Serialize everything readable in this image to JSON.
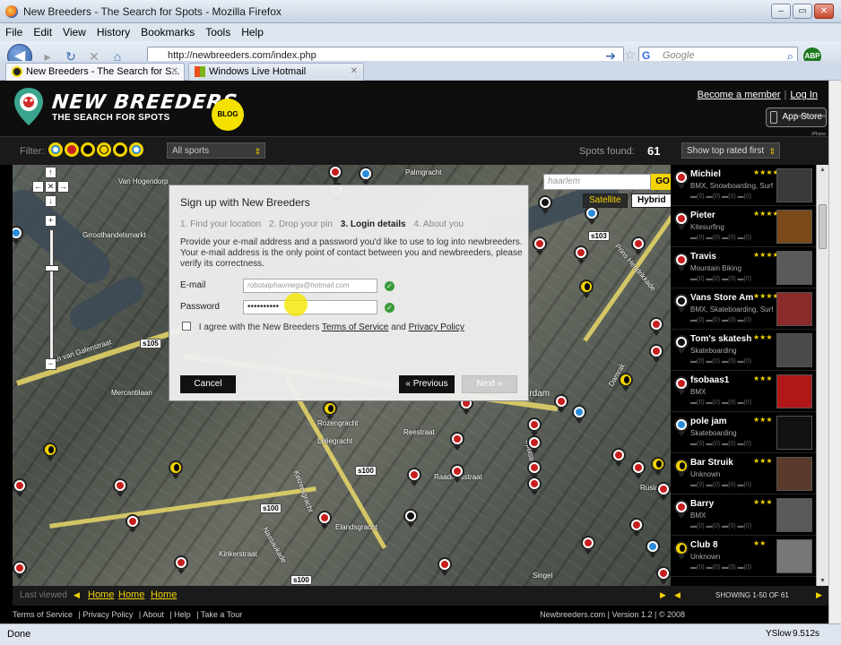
{
  "window": {
    "title": "New Breeders - The Search for Spots - Mozilla Firefox"
  },
  "menu": [
    "File",
    "Edit",
    "View",
    "History",
    "Bookmarks",
    "Tools",
    "Help"
  ],
  "nav": {
    "url": "http://newbreeders.com/index.php",
    "search_placeholder": "Google",
    "abp_label": "ABP"
  },
  "tabs": [
    {
      "label": "New Breeders - The Search for S...",
      "active": true
    },
    {
      "label": "Windows Live Hotmail",
      "active": false
    }
  ],
  "site": {
    "logo_title": "NEW BREEDERS",
    "logo_subtitle": "THE SEARCH FOR SPOTS",
    "logo_badge": "BLOG",
    "become_member": "Become a member",
    "separator": "|",
    "login": "Log In",
    "appstore_small": "Available on the iPhone",
    "appstore_label": "App Store"
  },
  "filterbar": {
    "filter_label": "Filter:",
    "sport_select": "All sports",
    "spots_found_label": "Spots found:",
    "spots_found_count": "61",
    "sort_select": "Show top rated first"
  },
  "map": {
    "search_value": "haarlem",
    "go_label": "GO",
    "satellite_label": "Satellite",
    "hybrid_label": "Hybrid",
    "streets": [
      "Van Hogendorp",
      "Grroothandelsmarkt",
      "Jan van Galenstraat",
      "Mercantilaan",
      "Damrak",
      "Spuistraat",
      "Rozengracht",
      "Leliegracht",
      "Keizersgracht",
      "Reestraat",
      "Raadhuisstraat",
      "Nassaukade",
      "Kinkerstraat",
      "Elandsgracht",
      "Singel",
      "Amsterdam",
      "Rusland",
      "Palmgracht",
      "Prins Hendrikkade"
    ],
    "route_badges": [
      "s103",
      "s105",
      "s100",
      "s100",
      "s100"
    ]
  },
  "signup": {
    "title": "Sign up with New Breeders",
    "steps": [
      "1. Find your location",
      "2. Drop your pin",
      "3. Login details",
      "4. About you"
    ],
    "current_step": "3. Login details",
    "description": "Provide your e-mail address and a password you'd like to use to log into newbreeders. Your e-mail address is the only point of contact between you and newbreeders, please verify its correctness.",
    "email_label": "E-mail",
    "email_value": "robotalphaomega@hotmail.com",
    "password_label": "Password",
    "password_value": "••••••••••",
    "agree_prefix": "I agree with the New Breeders",
    "terms_link": "Terms of Service",
    "agree_and": "and",
    "privacy_link": "Privacy Policy",
    "cancel_label": "Cancel",
    "previous_label": "« Previous",
    "next_label": "Next »"
  },
  "spots": [
    {
      "name": "Michiel",
      "stars": "★★★★",
      "sub": "BMX, Snowboarding, Surfi...",
      "icons": "▬(0) ▬(0) ▬(0) ▬(0)",
      "pin": "r",
      "thumb": "#3a3a3a"
    },
    {
      "name": "Pieter",
      "stars": "★★★★",
      "sub": "Kitesurfing",
      "icons": "▬(0) ▬(0) ▬(0) ▬(0)",
      "pin": "r",
      "thumb": "#7a4a1a"
    },
    {
      "name": "Travis",
      "stars": "★★★★",
      "sub": "Mountain Biking",
      "icons": "▬(0) ▬(0) ▬(0) ▬(0)",
      "pin": "r",
      "thumb": "#5a5a5a"
    },
    {
      "name": "Vans Store Am",
      "stars": "★★★★",
      "sub": "BMX, Skateboarding, Surfi...",
      "icons": "▬(0) ▬(0) ▬(0) ▬(0)",
      "pin": "k",
      "thumb": "#8a2a2a"
    },
    {
      "name": "Tom's skatesh",
      "stars": "★★★",
      "sub": "Skateboarding",
      "icons": "▬(0) ▬(0) ▬(0) ▬(0)",
      "pin": "k",
      "thumb": "#4a4a4a"
    },
    {
      "name": "fsobaas1",
      "stars": "★★★",
      "sub": "BMX",
      "icons": "▬(0) ▬(0) ▬(0) ▬(0)",
      "pin": "r",
      "thumb": "#b01818"
    },
    {
      "name": "pole jam",
      "stars": "★★★",
      "sub": "Skateboarding",
      "icons": "▬(0) ▬(0) ▬(0) ▬(0)",
      "pin": "b",
      "thumb": "#111"
    },
    {
      "name": "Bar Struik",
      "stars": "★★★",
      "sub": "Unknown",
      "icons": "▬(0) ▬(0) ▬(0) ▬(0)",
      "pin": "y",
      "thumb": "#5a3a2a"
    },
    {
      "name": "Barry",
      "stars": "★★★",
      "sub": "BMX",
      "icons": "▬(0) ▬(0) ▬(0) ▬(0)",
      "pin": "r",
      "thumb": "#5a5a5a"
    },
    {
      "name": "Club 8",
      "stars": "★★",
      "sub": "Unknown",
      "icons": "▬(0) ▬(0) ▬(0) ▬(0)",
      "pin": "y",
      "thumb": "#777"
    }
  ],
  "bottom": {
    "last_viewed": "Last viewed",
    "links": [
      "Home",
      "Home",
      "Home"
    ],
    "showing": "SHOWING 1-50 OF 61"
  },
  "footer": {
    "links": [
      "Terms of Service",
      "| Privacy Policy",
      "| About",
      "| Help",
      "| Take a Tour"
    ],
    "right": "Newbreeders.com | Version 1.2 | © 2008"
  },
  "status": {
    "text": "Done",
    "yslow": "YSlow",
    "yslow_value": "9.512s"
  }
}
